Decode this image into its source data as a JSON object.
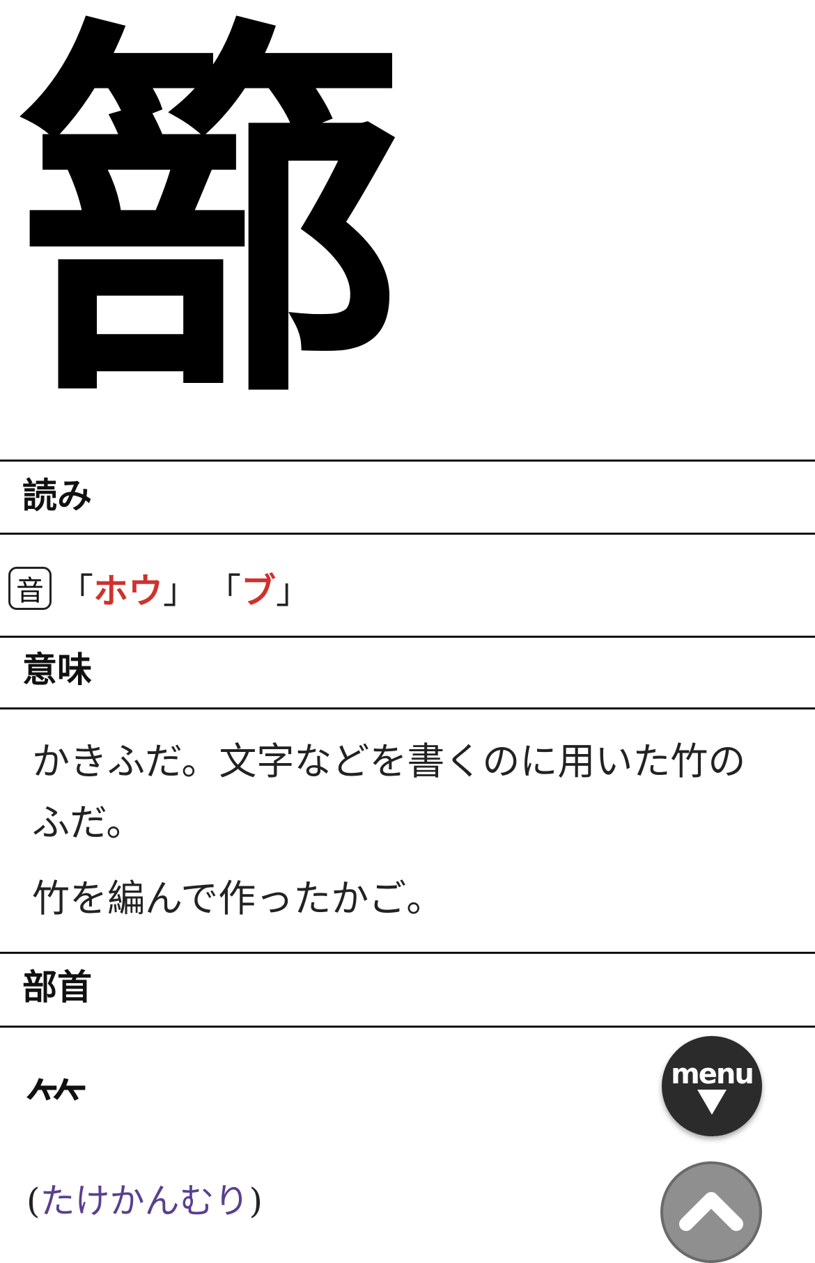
{
  "kanji": {
    "character": "篰"
  },
  "sections": {
    "yomi": {
      "title": "読み",
      "on_badge": "音",
      "readings": [
        "ホウ",
        "ブ"
      ]
    },
    "imi": {
      "title": "意味",
      "lines": [
        "かきふだ。文字などを書くのに用いた竹のふだ。",
        "竹を編んで作ったかご。"
      ]
    },
    "bushu": {
      "title": "部首",
      "radical": "⺮",
      "name": "たけかんむり"
    }
  },
  "nav": {
    "menu_label": "menu"
  },
  "colors": {
    "reading_accent": "#d0312d",
    "radical_name": "#5a3f8e"
  }
}
